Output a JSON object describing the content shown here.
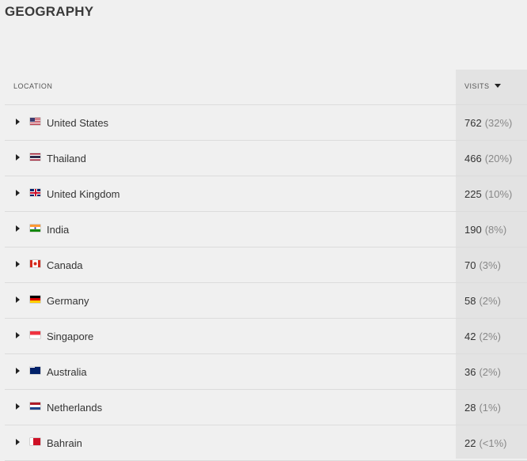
{
  "title": "GEOGRAPHY",
  "headers": {
    "location": "LOCATION",
    "visits": "VISITS"
  },
  "rows": [
    {
      "country": "United States",
      "flag": "us",
      "visits": "762",
      "pct": "(32%)"
    },
    {
      "country": "Thailand",
      "flag": "th",
      "visits": "466",
      "pct": "(20%)"
    },
    {
      "country": "United Kingdom",
      "flag": "gb",
      "visits": "225",
      "pct": "(10%)"
    },
    {
      "country": "India",
      "flag": "in",
      "visits": "190",
      "pct": "(8%)"
    },
    {
      "country": "Canada",
      "flag": "ca",
      "visits": "70",
      "pct": "(3%)"
    },
    {
      "country": "Germany",
      "flag": "de",
      "visits": "58",
      "pct": "(2%)"
    },
    {
      "country": "Singapore",
      "flag": "sg",
      "visits": "42",
      "pct": "(2%)"
    },
    {
      "country": "Australia",
      "flag": "au",
      "visits": "36",
      "pct": "(2%)"
    },
    {
      "country": "Netherlands",
      "flag": "nl",
      "visits": "28",
      "pct": "(1%)"
    },
    {
      "country": "Bahrain",
      "flag": "bh",
      "visits": "22",
      "pct": "(<1%)"
    }
  ],
  "icons": {
    "sort": "sort-descending-icon",
    "expand": "caret-right-icon"
  }
}
